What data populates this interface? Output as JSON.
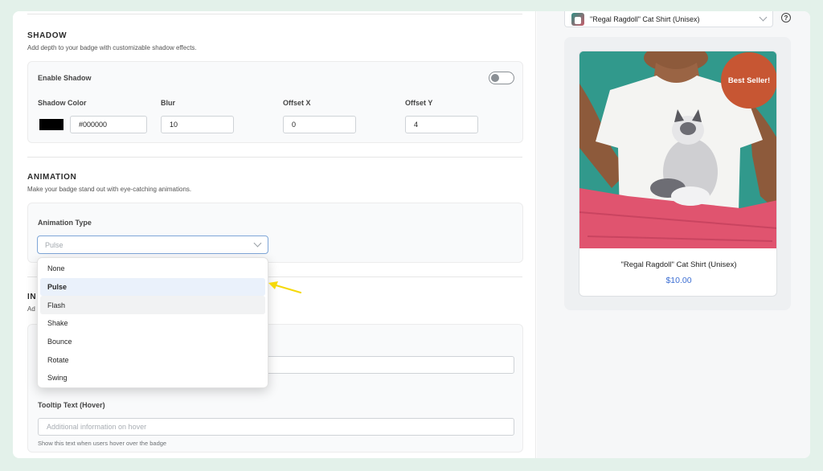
{
  "shadow": {
    "title": "SHADOW",
    "description": "Add depth to your badge with customizable shadow effects.",
    "enable_label": "Enable Shadow",
    "enabled": false,
    "color_label": "Shadow Color",
    "color_value": "#000000",
    "blur_label": "Blur",
    "blur_value": "10",
    "offset_x_label": "Offset X",
    "offset_x_value": "0",
    "offset_y_label": "Offset Y",
    "offset_y_value": "4"
  },
  "animation": {
    "title": "ANIMATION",
    "description": "Make your badge stand out with eye-catching animations.",
    "type_label": "Animation Type",
    "selected": "Pulse",
    "options": [
      "None",
      "Pulse",
      "Flash",
      "Shake",
      "Bounce",
      "Rotate",
      "Swing"
    ]
  },
  "info_section": {
    "title_fragment": "IN",
    "desc_fragment": "Ad",
    "tooltip_label": "Tooltip Text (Hover)",
    "tooltip_placeholder": "Additional information on hover",
    "tooltip_hint": "Show this text when users hover over the badge"
  },
  "preview": {
    "product_select": "\"Regal Ragdoll\" Cat Shirt (Unisex)",
    "help_glyph": "?",
    "badge_text": "Best Seller!",
    "product_title": "\"Regal Ragdoll\" Cat Shirt (Unisex)",
    "product_price": "$10.00"
  },
  "colors": {
    "background": "#e3f1ea",
    "badge": "#c75633",
    "price": "#3d6fd3",
    "select_border": "#7ea6d8",
    "arrow": "#f5d90a"
  }
}
